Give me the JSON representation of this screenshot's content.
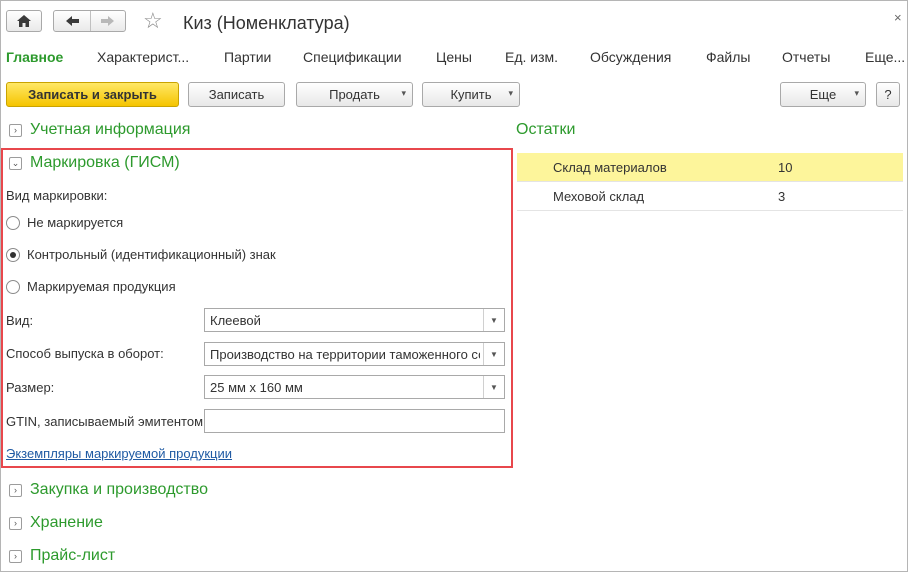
{
  "window": {
    "title": "Киз (Номенклатура)",
    "close_glyph": "×",
    "home_icon": "home-icon",
    "back_icon": "arrow-left-icon",
    "forward_icon": "arrow-right-icon",
    "favorite_icon": "star-icon"
  },
  "tabs": [
    {
      "label": "Главное",
      "active": true
    },
    {
      "label": "Характерист..."
    },
    {
      "label": "Партии"
    },
    {
      "label": "Спецификации"
    },
    {
      "label": "Цены"
    },
    {
      "label": "Ед. изм."
    },
    {
      "label": "Обсуждения"
    },
    {
      "label": "Файлы"
    },
    {
      "label": "Отчеты"
    },
    {
      "label": "Еще..."
    }
  ],
  "toolbar": {
    "save_close": "Записать и закрыть",
    "save": "Записать",
    "sell": "Продать",
    "buy": "Купить",
    "more": "Еще",
    "help": "?"
  },
  "groups": {
    "accounting": "Учетная информация",
    "marking": "Маркировка (ГИСМ)",
    "purchase": "Закупка и производство",
    "storage": "Хранение",
    "pricelist": "Прайс-лист"
  },
  "marking": {
    "kind_label": "Вид маркировки:",
    "options": [
      {
        "label": "Не маркируется",
        "selected": false
      },
      {
        "label": "Контрольный (идентификационный) знак",
        "selected": true
      },
      {
        "label": "Маркируемая продукция",
        "selected": false
      }
    ],
    "type_label": "Вид:",
    "type_value": "Клеевой",
    "release_label": "Способ выпуска в оборот:",
    "release_value": "Производство на территории таможенного со",
    "size_label": "Размер:",
    "size_value": "25 мм х 160 мм",
    "gtin_label": "GTIN, записываемый эмитентом:",
    "gtin_value": "",
    "link": "Экземпляры маркируемой продукции"
  },
  "stock": {
    "title": "Остатки",
    "rows": [
      {
        "warehouse": "Склад материалов",
        "qty": "10",
        "selected": true
      },
      {
        "warehouse": "Меховой склад",
        "qty": "3",
        "selected": false
      }
    ]
  },
  "colors": {
    "accent_green": "#2d9a2d",
    "primary_button": "#f5c400",
    "highlight_border": "#e8474c",
    "selected_row": "#fdf59b",
    "link": "#1f5aa3"
  }
}
